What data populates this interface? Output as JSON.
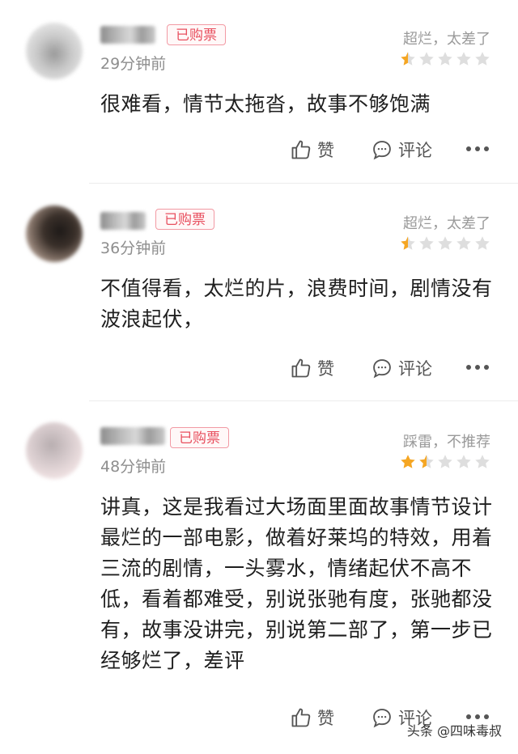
{
  "colors": {
    "accent": "#e8505f",
    "star_on": "#f5a623",
    "star_off": "#dedede",
    "muted": "#8e8e8e"
  },
  "labels": {
    "purchased": "已购票",
    "like": "赞",
    "comment": "评论"
  },
  "reviews": [
    {
      "time": "29分钟前",
      "verdict": "超烂，太差了",
      "rating": 0.5,
      "content": "很难看，情节太拖沓，故事不够饱满"
    },
    {
      "time": "36分钟前",
      "verdict": "超烂，太差了",
      "rating": 0.5,
      "content": "不值得看，太烂的片，浪费时间，剧情没有波浪起伏，"
    },
    {
      "time": "48分钟前",
      "verdict": "踩雷，不推荐",
      "rating": 1.5,
      "content": "讲真，这是我看过大场面里面故事情节设计最烂的一部电影，做着好莱坞的特效，用着三流的剧情，一头雾水，情绪起伏不高不低，看着都难受，别说张驰有度，张驰都没有，故事没讲完，别说第二部了，第一步已经够烂了，差评"
    }
  ],
  "watermark": "头条 @四味毒叔"
}
